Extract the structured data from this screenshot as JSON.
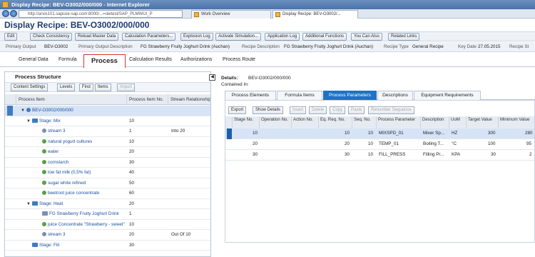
{
  "window": {
    "title": "Display Recipe: BEV-O3002/000/000 - Internet Explorer"
  },
  "browser": {
    "url": "http://arvis101.sapcoe-sap.com:8000/...=oletest/SAP_PLMWUI_P",
    "tabs": [
      {
        "label": "Work Overview"
      },
      {
        "label": "Display Recipe: BEV-O3002/..."
      }
    ]
  },
  "page": {
    "title": "Display Recipe: BEV-O3002/000/000"
  },
  "toolbar": {
    "buttons": [
      "Edit",
      "Check Consistency",
      "Reload Master Data",
      "Calculation Parameters...",
      "Explosion Log",
      "Activate Simulation...",
      "Application Log",
      "Additional Functions",
      "You Can Also",
      "Related Links"
    ]
  },
  "info": {
    "primary_output_label": "Primary Output",
    "primary_output": "BEV-O3002",
    "primary_output_desc_label": "Primary Output Description",
    "primary_output_desc": "FG Strawberry Fruity Joghurt Drink (Auchan)",
    "recipe_desc_label": "Recipe Description",
    "recipe_desc": "FG Strawberry Fruity Joghurt Drink (Auchan)",
    "recipe_type_label": "Recipe Type",
    "recipe_type": "General Recipe",
    "key_date_label": "Key Date",
    "key_date": "27.05.2015",
    "recipe_status_label": "Recipe St"
  },
  "main_tabs": [
    "General Data",
    "Formula",
    "Process",
    "Calculation Results",
    "Authorizations",
    "Process Route"
  ],
  "process_structure": {
    "title": "Process Structure",
    "toolbar": {
      "content_settings": "Content Settings",
      "levels": "Levels",
      "find": "Find",
      "items": "Items",
      "import": "Import"
    },
    "columns": [
      "Process Item",
      "Process Item No.",
      "Stream Relationship"
    ],
    "rows": [
      {
        "label": "BEV-O3002/000/000",
        "no": "",
        "rel": ""
      },
      {
        "label": "Stage: Mix",
        "no": "10",
        "rel": ""
      },
      {
        "label": "stream 3",
        "no": "1",
        "rel": "Into 20"
      },
      {
        "label": "natural yogurt cultures",
        "no": "10",
        "rel": ""
      },
      {
        "label": "water",
        "no": "20",
        "rel": ""
      },
      {
        "label": "cornstarch",
        "no": "30",
        "rel": ""
      },
      {
        "label": "low fat milk (0,5% fat)",
        "no": "40",
        "rel": ""
      },
      {
        "label": "sugar white refined",
        "no": "50",
        "rel": ""
      },
      {
        "label": "beetroot juice concentrate",
        "no": "60",
        "rel": ""
      },
      {
        "label": "Stage: Heat",
        "no": "20",
        "rel": ""
      },
      {
        "label": "FG Strawberry Fruity Joghurt Drink",
        "no": "1",
        "rel": ""
      },
      {
        "label": "juice Concentrate \"Strawberry - sweet\"",
        "no": "10",
        "rel": ""
      },
      {
        "label": "stream 3",
        "no": "20",
        "rel": "Out Of 10"
      },
      {
        "label": "Stage: Fill",
        "no": "30",
        "rel": ""
      }
    ]
  },
  "details": {
    "label": "Details:",
    "value": "BEV-O3002/000/000",
    "contained_in": "Contained In:",
    "tabs": [
      "Process Elements",
      "Formula Items",
      "Process Parameters",
      "Descriptions",
      "Equipment Requirements"
    ],
    "toolbar": [
      "Export",
      "Show Details",
      "Insert",
      "Delete",
      "Copy",
      "Paste",
      "Renumber Sequence"
    ],
    "columns": [
      "Stage No.",
      "Operation No.",
      "Action No.",
      "Eq. Req. No.",
      "Seq. No.",
      "Process Parameter",
      "Description",
      "UoM",
      "Target Value",
      "Minimum Value"
    ],
    "rows": [
      {
        "stage": "10",
        "op": "",
        "action": "",
        "eq": "10",
        "seq": "10",
        "param": "MIXSPD_01",
        "desc": "Mixer Sp...",
        "uom": "HZ",
        "target": "300",
        "min": "280"
      },
      {
        "stage": "20",
        "op": "",
        "action": "",
        "eq": "20",
        "seq": "10",
        "param": "TEMP_01",
        "desc": "Boiling T...",
        "uom": "°C",
        "target": "100",
        "min": "95"
      },
      {
        "stage": "30",
        "op": "",
        "action": "",
        "eq": "30",
        "seq": "10",
        "param": "FILL_PRESS",
        "desc": "Filling Pr...",
        "uom": "KPA",
        "target": "30",
        "min": "2"
      }
    ]
  }
}
